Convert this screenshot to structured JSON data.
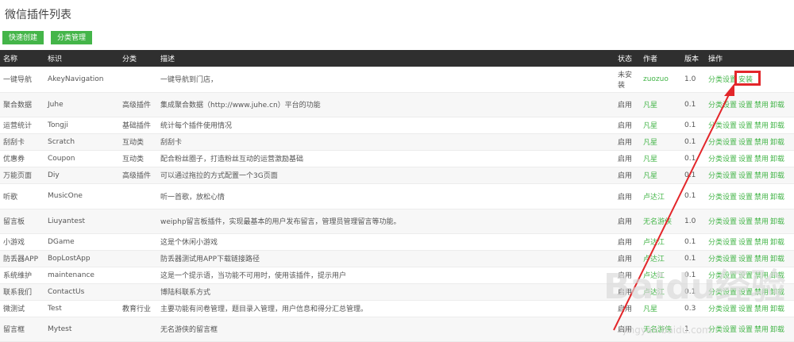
{
  "title": "微信插件列表",
  "toolbar": {
    "quick_create": "快速创建",
    "category_manage": "分类管理"
  },
  "columns": [
    "名称",
    "标识",
    "分类",
    "描述",
    "状态",
    "作者",
    "版本",
    "操作"
  ],
  "rows": [
    {
      "name": "一键导航",
      "id": "AkeyNavigation",
      "category": "",
      "desc": "一键导航到门店，",
      "status": "未安装",
      "author": "zuozuo",
      "version": "1.0",
      "actions": [
        "分类设置",
        "安装"
      ]
    },
    {
      "name": "聚合数据",
      "id": "Juhe",
      "category": "高级插件",
      "desc": "集成聚合数据（http://www.juhe.cn）平台的功能",
      "status": "启用",
      "author": "凡星",
      "version": "0.1",
      "actions": [
        "分类设置",
        "设置",
        "禁用",
        "卸载"
      ]
    },
    {
      "name": "运营统计",
      "id": "Tongji",
      "category": "基础插件",
      "desc": "统计每个插件使用情况",
      "status": "启用",
      "author": "凡星",
      "version": "0.1",
      "actions": [
        "分类设置",
        "设置",
        "禁用",
        "卸载"
      ]
    },
    {
      "name": "刮刮卡",
      "id": "Scratch",
      "category": "互动类",
      "desc": "刮刮卡",
      "status": "启用",
      "author": "凡星",
      "version": "0.1",
      "actions": [
        "分类设置",
        "设置",
        "禁用",
        "卸载"
      ]
    },
    {
      "name": "优惠券",
      "id": "Coupon",
      "category": "互动类",
      "desc": "配合粉丝圈子，打造粉丝互动的运营激励基础",
      "status": "启用",
      "author": "凡星",
      "version": "0.1",
      "actions": [
        "分类设置",
        "设置",
        "禁用",
        "卸载"
      ]
    },
    {
      "name": "万能页面",
      "id": "Diy",
      "category": "高级插件",
      "desc": "可以通过拖拉的方式配置一个3G页面",
      "status": "启用",
      "author": "凡星",
      "version": "0.1",
      "actions": [
        "分类设置",
        "设置",
        "禁用",
        "卸载"
      ]
    },
    {
      "name": "听歌",
      "id": "MusicOne",
      "category": "",
      "desc": "听一首歌，放松心情",
      "status": "启用",
      "author": "卢达江",
      "version": "0.1",
      "actions": [
        "分类设置",
        "设置",
        "禁用",
        "卸载"
      ]
    },
    {
      "name": "留言板",
      "id": "Liuyantest",
      "category": "",
      "desc": "weiphp留言板插件，实现最基本的用户发布留言，管理员管理留言等功能。",
      "status": "启用",
      "author": "无名游侠",
      "version": "1.0",
      "actions": [
        "分类设置",
        "设置",
        "禁用",
        "卸载"
      ]
    },
    {
      "name": "小游戏",
      "id": "DGame",
      "category": "",
      "desc": "这是个休闲小游戏",
      "status": "启用",
      "author": "卢达江",
      "version": "0.1",
      "actions": [
        "分类设置",
        "设置",
        "禁用",
        "卸载"
      ]
    },
    {
      "name": "防丢器APP",
      "id": "BopLostApp",
      "category": "",
      "desc": "防丢器测试用APP下载链接路径",
      "status": "启用",
      "author": "卢达江",
      "version": "0.1",
      "actions": [
        "分类设置",
        "设置",
        "禁用",
        "卸载"
      ]
    },
    {
      "name": "系统维护",
      "id": "maintenance",
      "category": "",
      "desc": "这是一个提示语，当功能不可用时，使用该插件，提示用户",
      "status": "启用",
      "author": "卢达江",
      "version": "0.1",
      "actions": [
        "分类设置",
        "设置",
        "禁用",
        "卸载"
      ]
    },
    {
      "name": "联系我们",
      "id": "ContactUs",
      "category": "",
      "desc": "博陆科联系方式",
      "status": "启用",
      "author": "卢达江",
      "version": "0.1",
      "actions": [
        "分类设置",
        "设置",
        "禁用",
        "卸载"
      ]
    },
    {
      "name": "微测试",
      "id": "Test",
      "category": "教育行业",
      "desc": "主要功能有问卷管理，题目录入管理，用户信息和得分汇总管理。",
      "status": "启用",
      "author": "凡星",
      "version": "0.3",
      "actions": [
        "分类设置",
        "设置",
        "禁用",
        "卸载"
      ]
    },
    {
      "name": "留言框",
      "id": "Mytest",
      "category": "",
      "desc": "无名游侠的留言框",
      "status": "启用",
      "author": "无名游侠",
      "version": "1",
      "actions": [
        "分类设置",
        "设置",
        "禁用",
        "卸载"
      ]
    }
  ],
  "watermark": "Baidu经验",
  "watermark_sub": "jingyan.baidu.com",
  "accent_color": "#44b549",
  "highlight_color": "#e3262a"
}
